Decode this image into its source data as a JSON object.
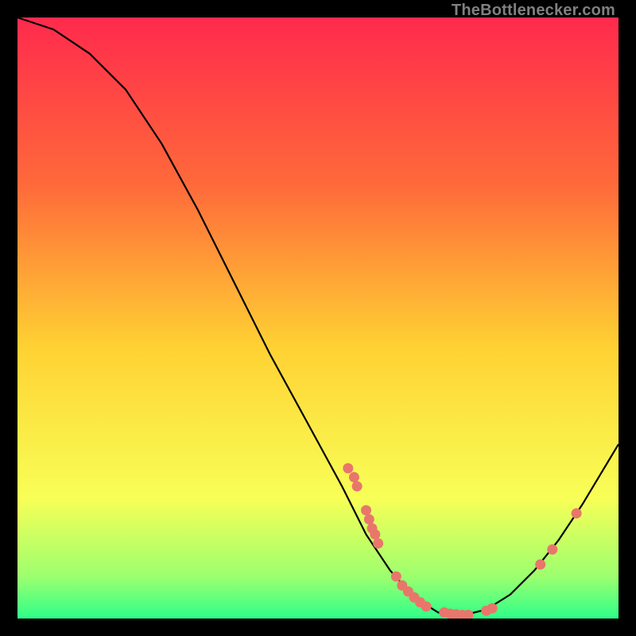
{
  "watermark": "TheBottlenecker.com",
  "gradient": {
    "top": "#ff2a4d",
    "mid1": "#ff6a3a",
    "mid2": "#ffd233",
    "mid3": "#f8ff57",
    "bottom_band_top": "#9dff6e",
    "bottom_band": "#2eff8a"
  },
  "curve_color": "#000000",
  "dot_color": "#e9766b",
  "chart_data": {
    "type": "line",
    "title": "",
    "xlabel": "",
    "ylabel": "",
    "xlim": [
      0,
      100
    ],
    "ylim": [
      0,
      100
    ],
    "curve": [
      {
        "x": 0,
        "y": 100
      },
      {
        "x": 6,
        "y": 98
      },
      {
        "x": 12,
        "y": 94
      },
      {
        "x": 18,
        "y": 88
      },
      {
        "x": 24,
        "y": 79
      },
      {
        "x": 30,
        "y": 68
      },
      {
        "x": 36,
        "y": 56
      },
      {
        "x": 42,
        "y": 44
      },
      {
        "x": 48,
        "y": 33
      },
      {
        "x": 54,
        "y": 22
      },
      {
        "x": 58,
        "y": 14
      },
      {
        "x": 62,
        "y": 8
      },
      {
        "x": 66,
        "y": 3.5
      },
      {
        "x": 70,
        "y": 1
      },
      {
        "x": 74,
        "y": 0.5
      },
      {
        "x": 78,
        "y": 1.5
      },
      {
        "x": 82,
        "y": 4
      },
      {
        "x": 86,
        "y": 8
      },
      {
        "x": 90,
        "y": 13
      },
      {
        "x": 94,
        "y": 19
      },
      {
        "x": 100,
        "y": 29
      }
    ],
    "dots": [
      {
        "x": 55,
        "y": 25
      },
      {
        "x": 56,
        "y": 23.5
      },
      {
        "x": 56.5,
        "y": 22
      },
      {
        "x": 58,
        "y": 18
      },
      {
        "x": 58.5,
        "y": 16.5
      },
      {
        "x": 59,
        "y": 15
      },
      {
        "x": 59.5,
        "y": 14
      },
      {
        "x": 60,
        "y": 12.5
      },
      {
        "x": 63,
        "y": 7
      },
      {
        "x": 64,
        "y": 5.5
      },
      {
        "x": 65,
        "y": 4.5
      },
      {
        "x": 66,
        "y": 3.5
      },
      {
        "x": 67,
        "y": 2.7
      },
      {
        "x": 68,
        "y": 2
      },
      {
        "x": 71,
        "y": 1
      },
      {
        "x": 72,
        "y": 0.8
      },
      {
        "x": 73,
        "y": 0.7
      },
      {
        "x": 74,
        "y": 0.6
      },
      {
        "x": 75,
        "y": 0.6
      },
      {
        "x": 78,
        "y": 1.3
      },
      {
        "x": 79,
        "y": 1.7
      },
      {
        "x": 87,
        "y": 9
      },
      {
        "x": 89,
        "y": 11.5
      },
      {
        "x": 93,
        "y": 17.5
      }
    ]
  }
}
